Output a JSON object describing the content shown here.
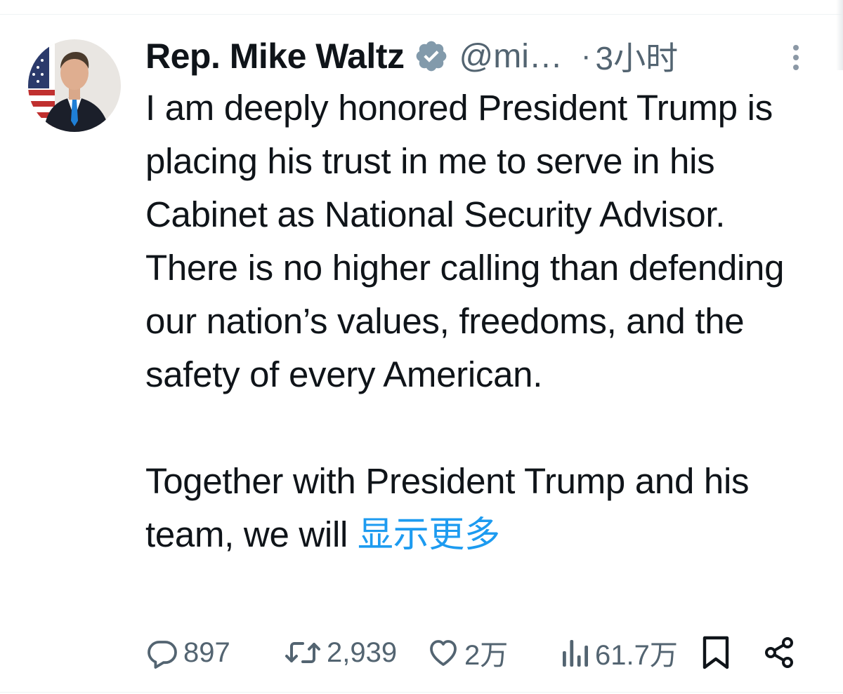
{
  "tweet": {
    "author_name": "Rep. Mike Waltz",
    "handle": "@mi…",
    "separator": "·",
    "time": "3小时",
    "paragraphs": [
      "I am deeply honored President Trump is placing his trust in me to serve in his Cabinet as National Security Advisor. There is no higher calling than defending our nation’s values, freedoms, and the safety of every American.",
      "Together with President Trump and his team, we will "
    ],
    "show_more_label": "显示更多"
  },
  "actions": {
    "replies": "897",
    "reposts": "2,939",
    "likes": "2万",
    "views": "61.7万"
  },
  "icons": {
    "verified": "verified-badge-icon",
    "more": "more-vertical-icon",
    "reply": "reply-icon",
    "repost": "repost-icon",
    "like": "heart-icon",
    "views": "views-icon",
    "bookmark": "bookmark-icon",
    "share": "share-icon"
  },
  "colors": {
    "text": "#0f1419",
    "secondary": "#536471",
    "link": "#1d9bf0",
    "divider": "#eff3f4",
    "verified_badge": "#829aab"
  }
}
